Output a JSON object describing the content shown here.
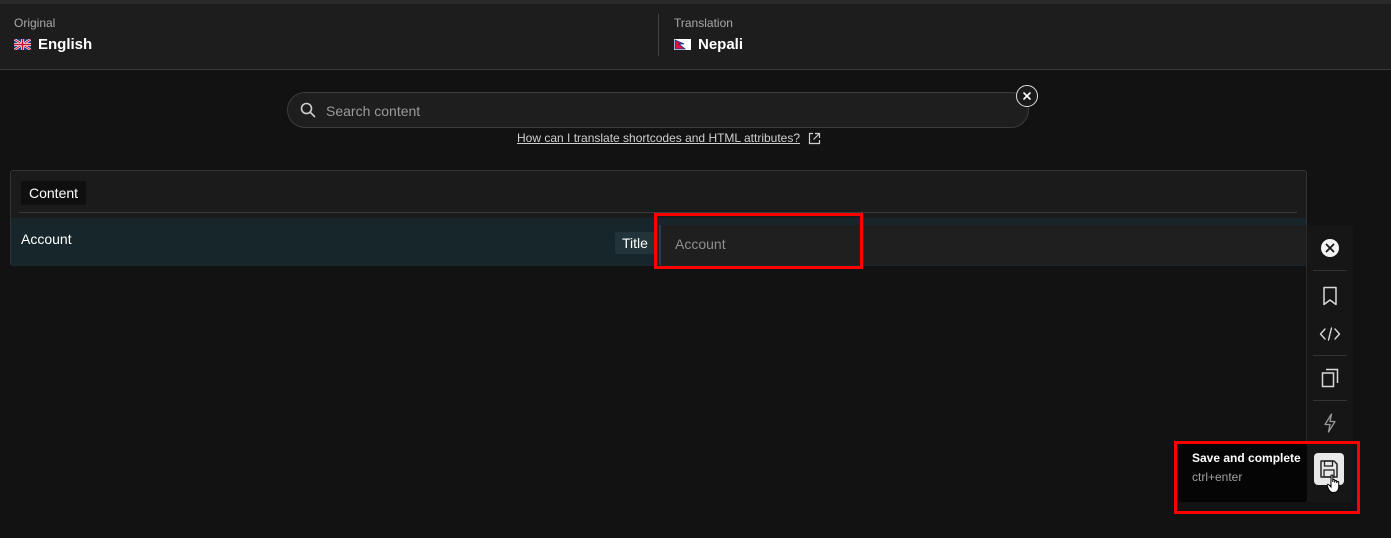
{
  "header": {
    "original": {
      "caption": "Original",
      "language": "English",
      "flag_icon": "uk-flag-icon"
    },
    "translation": {
      "caption": "Translation",
      "language": "Nepali",
      "flag_icon": "nepal-flag-icon"
    }
  },
  "search": {
    "placeholder": "Search content",
    "value": ""
  },
  "help_link": {
    "label": "How can I translate shortcodes and HTML attributes?"
  },
  "content": {
    "section_label": "Content",
    "rows": [
      {
        "source": "Account",
        "type": "Title",
        "translation": "Account"
      }
    ]
  },
  "toolbar": {
    "icons": [
      "close-icon",
      "bookmark-icon",
      "code-icon",
      "copy-icon",
      "lightning-icon",
      "save-icon"
    ]
  },
  "tooltip": {
    "title": "Save and complete",
    "shortcut": "ctrl+enter"
  },
  "colors": {
    "highlight": "#ff0000",
    "background": "#121212",
    "row_active": "#17262a"
  }
}
